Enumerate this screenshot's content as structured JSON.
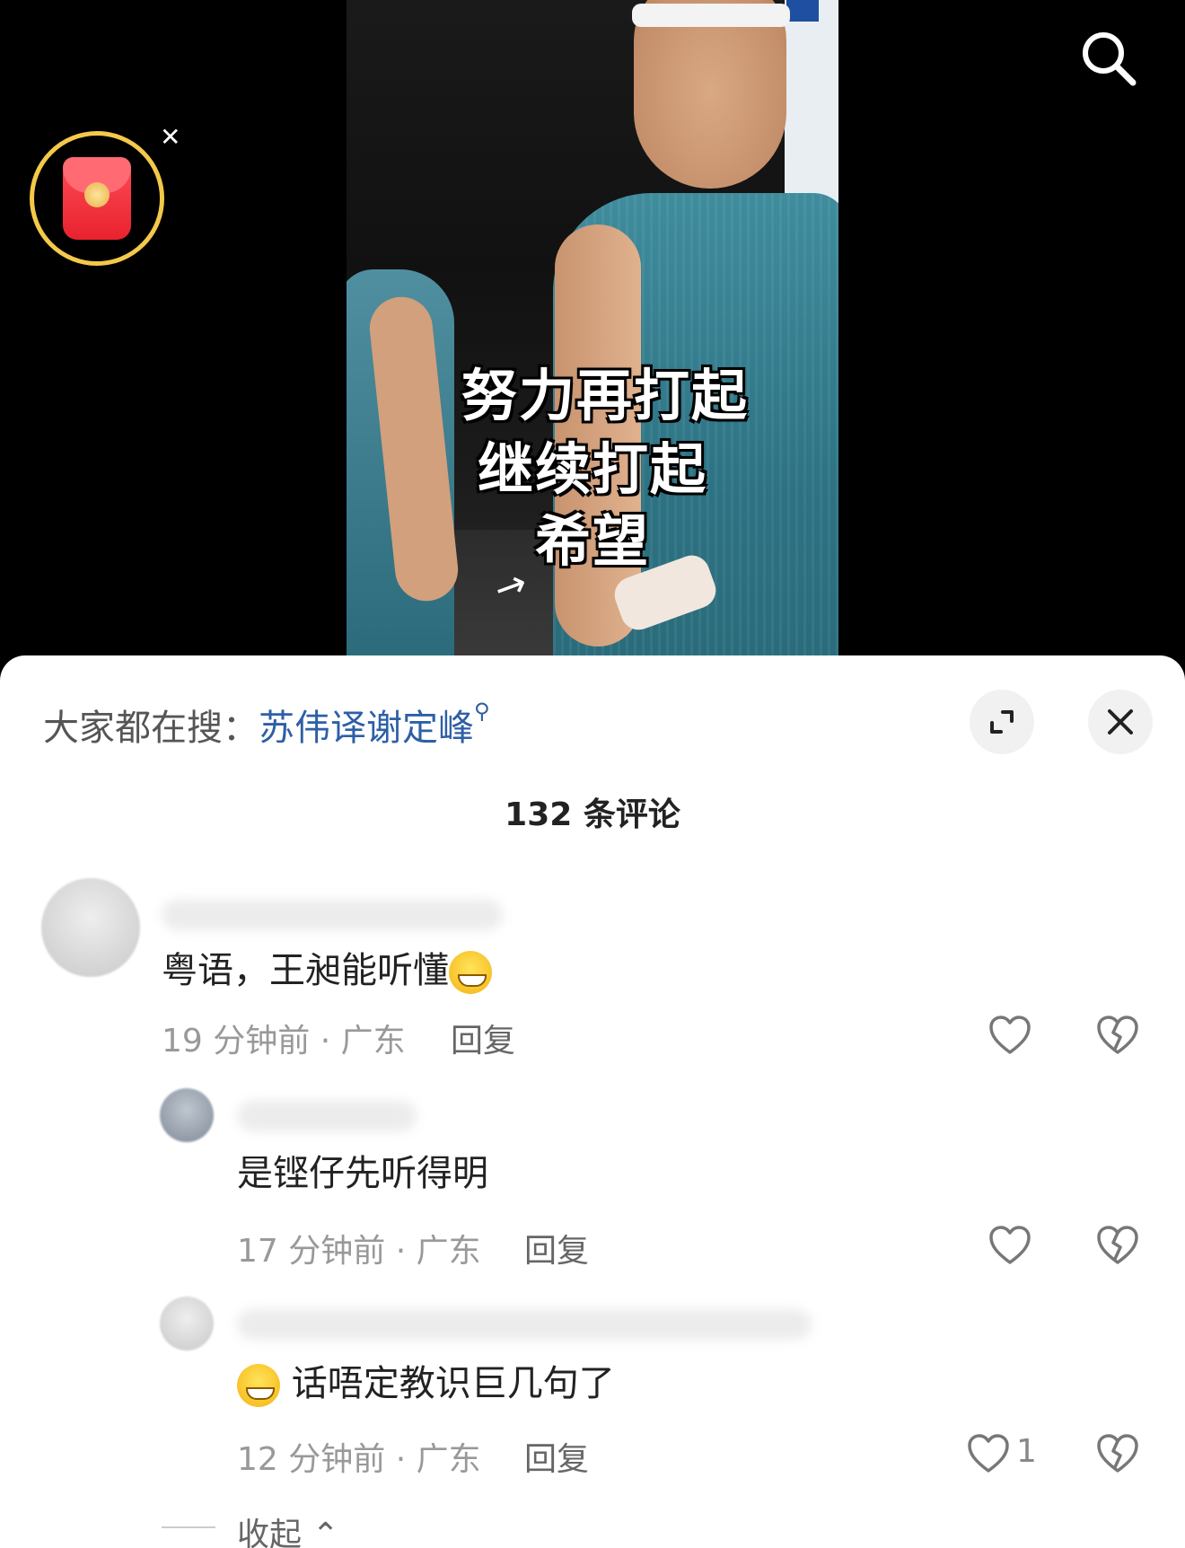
{
  "video": {
    "caption_lines": [
      "努力再打起",
      "继续打起",
      "希望"
    ]
  },
  "overlay": {
    "red_packet_icon": "red-envelope-icon",
    "close_icon": "close-icon",
    "search_icon": "search-icon"
  },
  "panel": {
    "hot_search_prefix": "大家都在搜：",
    "hot_search_term": "苏伟译谢定峰",
    "comment_count_title": "132 条评论",
    "comments": [
      {
        "text": "粤语，王昶能听懂",
        "time": "19 分钟前 · 广东",
        "reply_label": "回复",
        "likes": ""
      },
      {
        "text": "是铿仔先听得明",
        "time": "17 分钟前 · 广东",
        "reply_label": "回复",
        "likes": ""
      },
      {
        "text": "话唔定教识巨几句了",
        "time": "12 分钟前 · 广东",
        "reply_label": "回复",
        "likes": "1"
      }
    ],
    "collapse_label": "收起"
  },
  "colors": {
    "link_blue": "#2e5fa6",
    "ring_gold": "#f4c94a",
    "packet_red": "#e8222e"
  }
}
